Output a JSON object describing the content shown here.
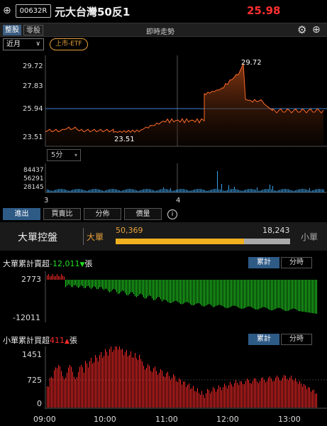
{
  "header": {
    "plus_icon": "plus-circle-icon",
    "stock_code": "00632R",
    "stock_name": "元大台灣50反1",
    "price": "25.98",
    "price_color": "#ff3030"
  },
  "toolbar": {
    "whole_lot": "整股",
    "odd_lot": "零股",
    "title": "即時走勢",
    "gear_icon": "gear-icon",
    "add_icon": "plus-circle-icon"
  },
  "month_select": {
    "value": "近月"
  },
  "etf_tag": "上市-ETF",
  "main_chart": {
    "y_ticks": [
      "29.72",
      "27.83",
      "25.94",
      "23.51"
    ],
    "high_label": "29.72",
    "low_label": "23.51",
    "ref_price": 25.94
  },
  "period_select": {
    "value": "5分"
  },
  "volume_chart": {
    "y_ticks": [
      "84437",
      "56291",
      "28145"
    ],
    "x_labels": [
      "3",
      "4"
    ]
  },
  "tabs": [
    "進出",
    "買賣比",
    "分佈",
    "價量"
  ],
  "info_icon": "info-icon",
  "big_panel": {
    "title": "大單控盤",
    "big_label": "大單",
    "big_value": "50,369",
    "small_value": "18,243",
    "small_label": "小單",
    "big_ratio": 0.734
  },
  "big_net": {
    "title_prefix": "大單累計賣超",
    "title_value": "-12,011",
    "title_suffix": "張",
    "seg_cumulative": "累計",
    "seg_timed": "分時",
    "y_ticks": [
      "2773",
      "-12011"
    ]
  },
  "small_net": {
    "title_prefix": "小單累計買超",
    "title_value": "411",
    "title_suffix": "張",
    "seg_cumulative": "累計",
    "seg_timed": "分時",
    "y_ticks": [
      "1451",
      "725",
      "0"
    ],
    "x_labels": [
      "09:00",
      "10:00",
      "11:00",
      "12:00",
      "13:00"
    ]
  },
  "colors": {
    "up": "#ff2a2a",
    "down": "#22dd22",
    "accent": "#e8a23a",
    "price_line": "#ff6a2a",
    "ref_line": "#3b82d0",
    "volume": "#3aa0e8"
  }
}
